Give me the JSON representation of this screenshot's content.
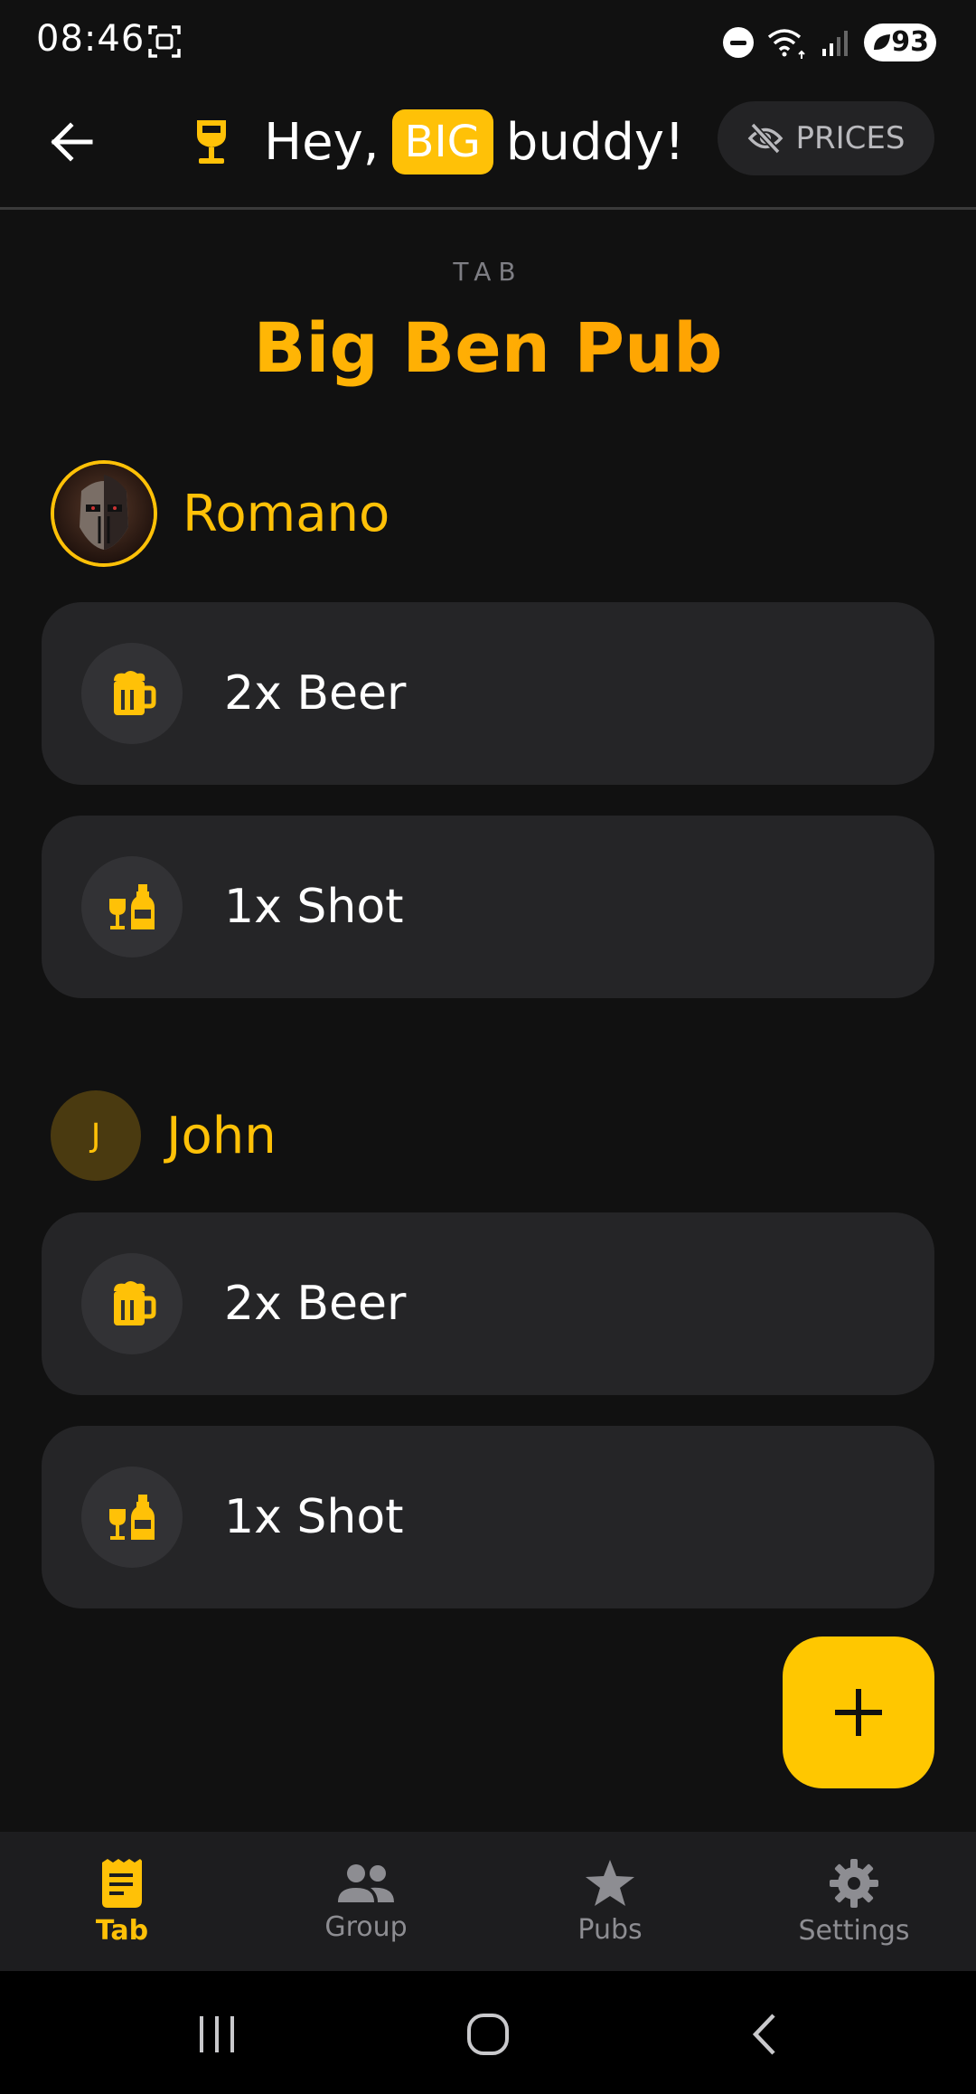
{
  "status_bar": {
    "time": "08:46",
    "battery": "93"
  },
  "header": {
    "greeting_prefix": "Hey,",
    "badge": "BIG",
    "greeting_suffix": "buddy!",
    "prices_label": "PRICES"
  },
  "tab": {
    "caption": "TAB",
    "pub_name": "Big Ben Pub"
  },
  "people": [
    {
      "name": "Romano",
      "items": [
        {
          "label": "2x Beer",
          "icon": "beer-mug-icon"
        },
        {
          "label": "1x Shot",
          "icon": "shot-bottle-icon"
        }
      ]
    },
    {
      "name": "John",
      "initial": "J",
      "items": [
        {
          "label": "2x Beer",
          "icon": "beer-mug-icon"
        },
        {
          "label": "1x Shot",
          "icon": "shot-bottle-icon"
        }
      ]
    }
  ],
  "bottom_nav": {
    "items": [
      {
        "label": "Tab",
        "icon": "receipt-icon",
        "active": true
      },
      {
        "label": "Group",
        "icon": "group-icon",
        "active": false
      },
      {
        "label": "Pubs",
        "icon": "star-icon",
        "active": false
      },
      {
        "label": "Settings",
        "icon": "gear-icon",
        "active": false
      }
    ]
  },
  "colors": {
    "accent": "#FFC107",
    "background": "#111111",
    "card": "#252527"
  }
}
